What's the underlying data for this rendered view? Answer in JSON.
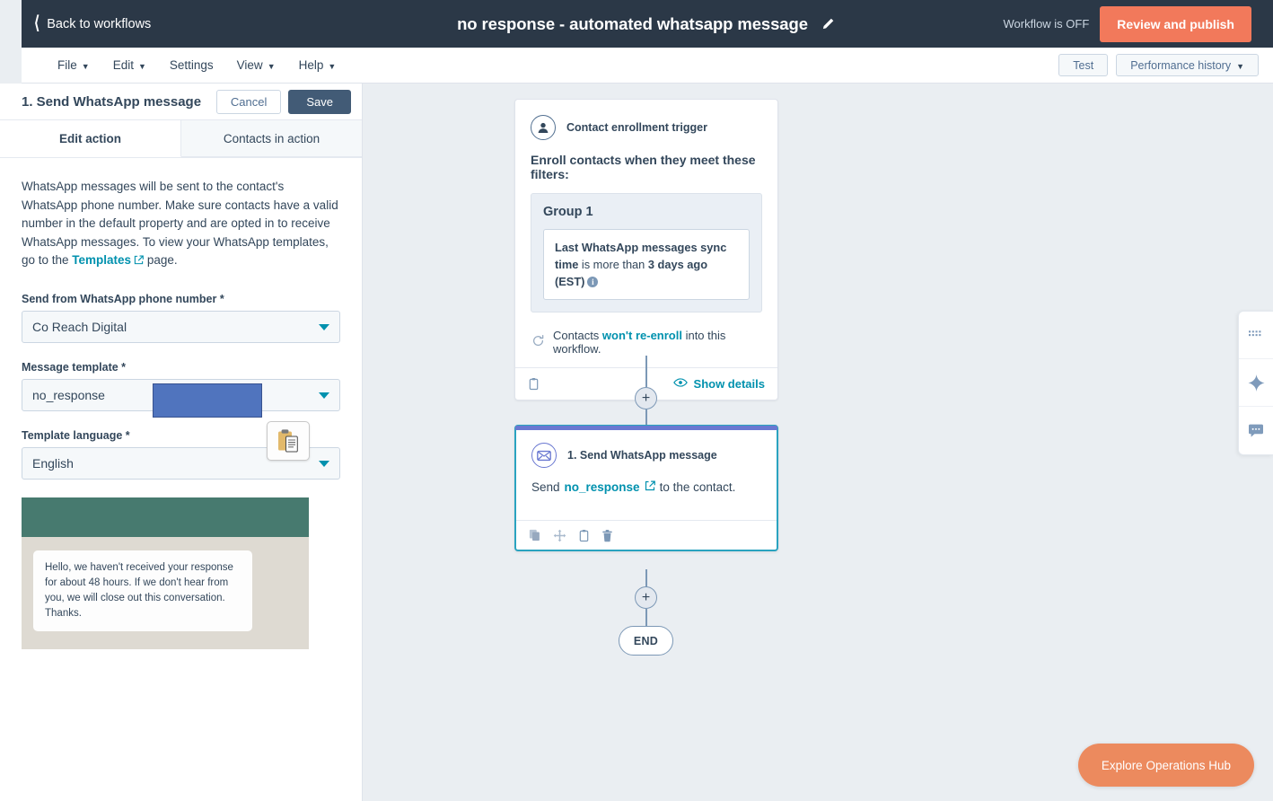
{
  "topnav": {
    "back_label": "Back to workflows",
    "back_icon": "chevron-left-icon",
    "workflow_title": "no response - automated whatsapp message",
    "edit_icon": "pencil-icon",
    "status_text": "Workflow is OFF",
    "publish_label": "Review and publish",
    "publish_color": "#f2795b",
    "bg_color": "#2b3847"
  },
  "menubar": {
    "items": [
      {
        "label": "File",
        "has_caret": true
      },
      {
        "label": "Edit",
        "has_caret": true
      },
      {
        "label": "Settings",
        "has_caret": false
      },
      {
        "label": "View",
        "has_caret": true
      },
      {
        "label": "Help",
        "has_caret": true
      }
    ],
    "test_label": "Test",
    "performance_label": "Performance history"
  },
  "panel": {
    "title": "1. Send WhatsApp message",
    "cancel_label": "Cancel",
    "save_label": "Save",
    "save_color": "#425b76",
    "tabs": [
      {
        "label": "Edit action",
        "active": true
      },
      {
        "label": "Contacts in action",
        "active": false
      }
    ],
    "intro_part1": "WhatsApp messages will be sent to the contact's WhatsApp phone number. Make sure contacts have a valid number in the default property and are opted in to receive WhatsApp messages. To view your WhatsApp templates, go to the ",
    "intro_link": "Templates",
    "intro_part2": " page.",
    "fields": [
      {
        "label": "Send from WhatsApp phone number *",
        "value": "Co Reach Digital",
        "redacted": true
      },
      {
        "label": "Message template *",
        "value": "no_response",
        "redacted": false
      },
      {
        "label": "Template language *",
        "value": "English",
        "redacted": false
      }
    ],
    "overlay": {
      "redaction_color": "#5074be",
      "clipboard_icon": "clipboard-icon"
    },
    "preview": {
      "header_color": "#477a6f",
      "body_color": "#dedad2",
      "message": "Hello, we haven't received your response for about 48 hours. If we don't hear from you, we will close out this conversation. Thanks."
    }
  },
  "canvas": {
    "background": "#eaeef2",
    "trigger": {
      "icon": "contact-person-icon",
      "header": "Contact enrollment trigger",
      "subtitle": "Enroll contacts when they meet these filters:",
      "group_title": "Group 1",
      "filter_property": "Last WhatsApp messages sync time",
      "filter_operator": "is more than",
      "filter_value": "3 days ago (EST)",
      "info_icon": "info-icon",
      "reenroll_icon": "refresh-icon",
      "reenroll_prefix": "Contacts ",
      "reenroll_emphasis": "won't re-enroll",
      "reenroll_suffix": " into this workflow.",
      "footer_clipboard_icon": "clipboard-icon",
      "show_details_label": "Show details",
      "show_details_icon": "eye-icon"
    },
    "action": {
      "icon": "envelope-icon",
      "header": "1. Send WhatsApp message",
      "text_prefix": "Send ",
      "template_link": "no_response",
      "external_icon": "external-link-icon",
      "text_suffix": " to the contact.",
      "accent_top_color": "#6a78d1",
      "selected_border_color": "#2aa3c0",
      "footer_icons": [
        "copy-icon",
        "move-icon",
        "clipboard-icon",
        "trash-icon"
      ]
    },
    "plus_label": "+",
    "end_label": "END"
  },
  "right_rail": {
    "items": [
      {
        "icon": "grid-dots-icon"
      },
      {
        "icon": "sparkle-icon"
      },
      {
        "icon": "chat-bubble-icon"
      }
    ]
  },
  "ops_hub": {
    "label": "Explore Operations Hub",
    "color": "#ec8a5e"
  }
}
